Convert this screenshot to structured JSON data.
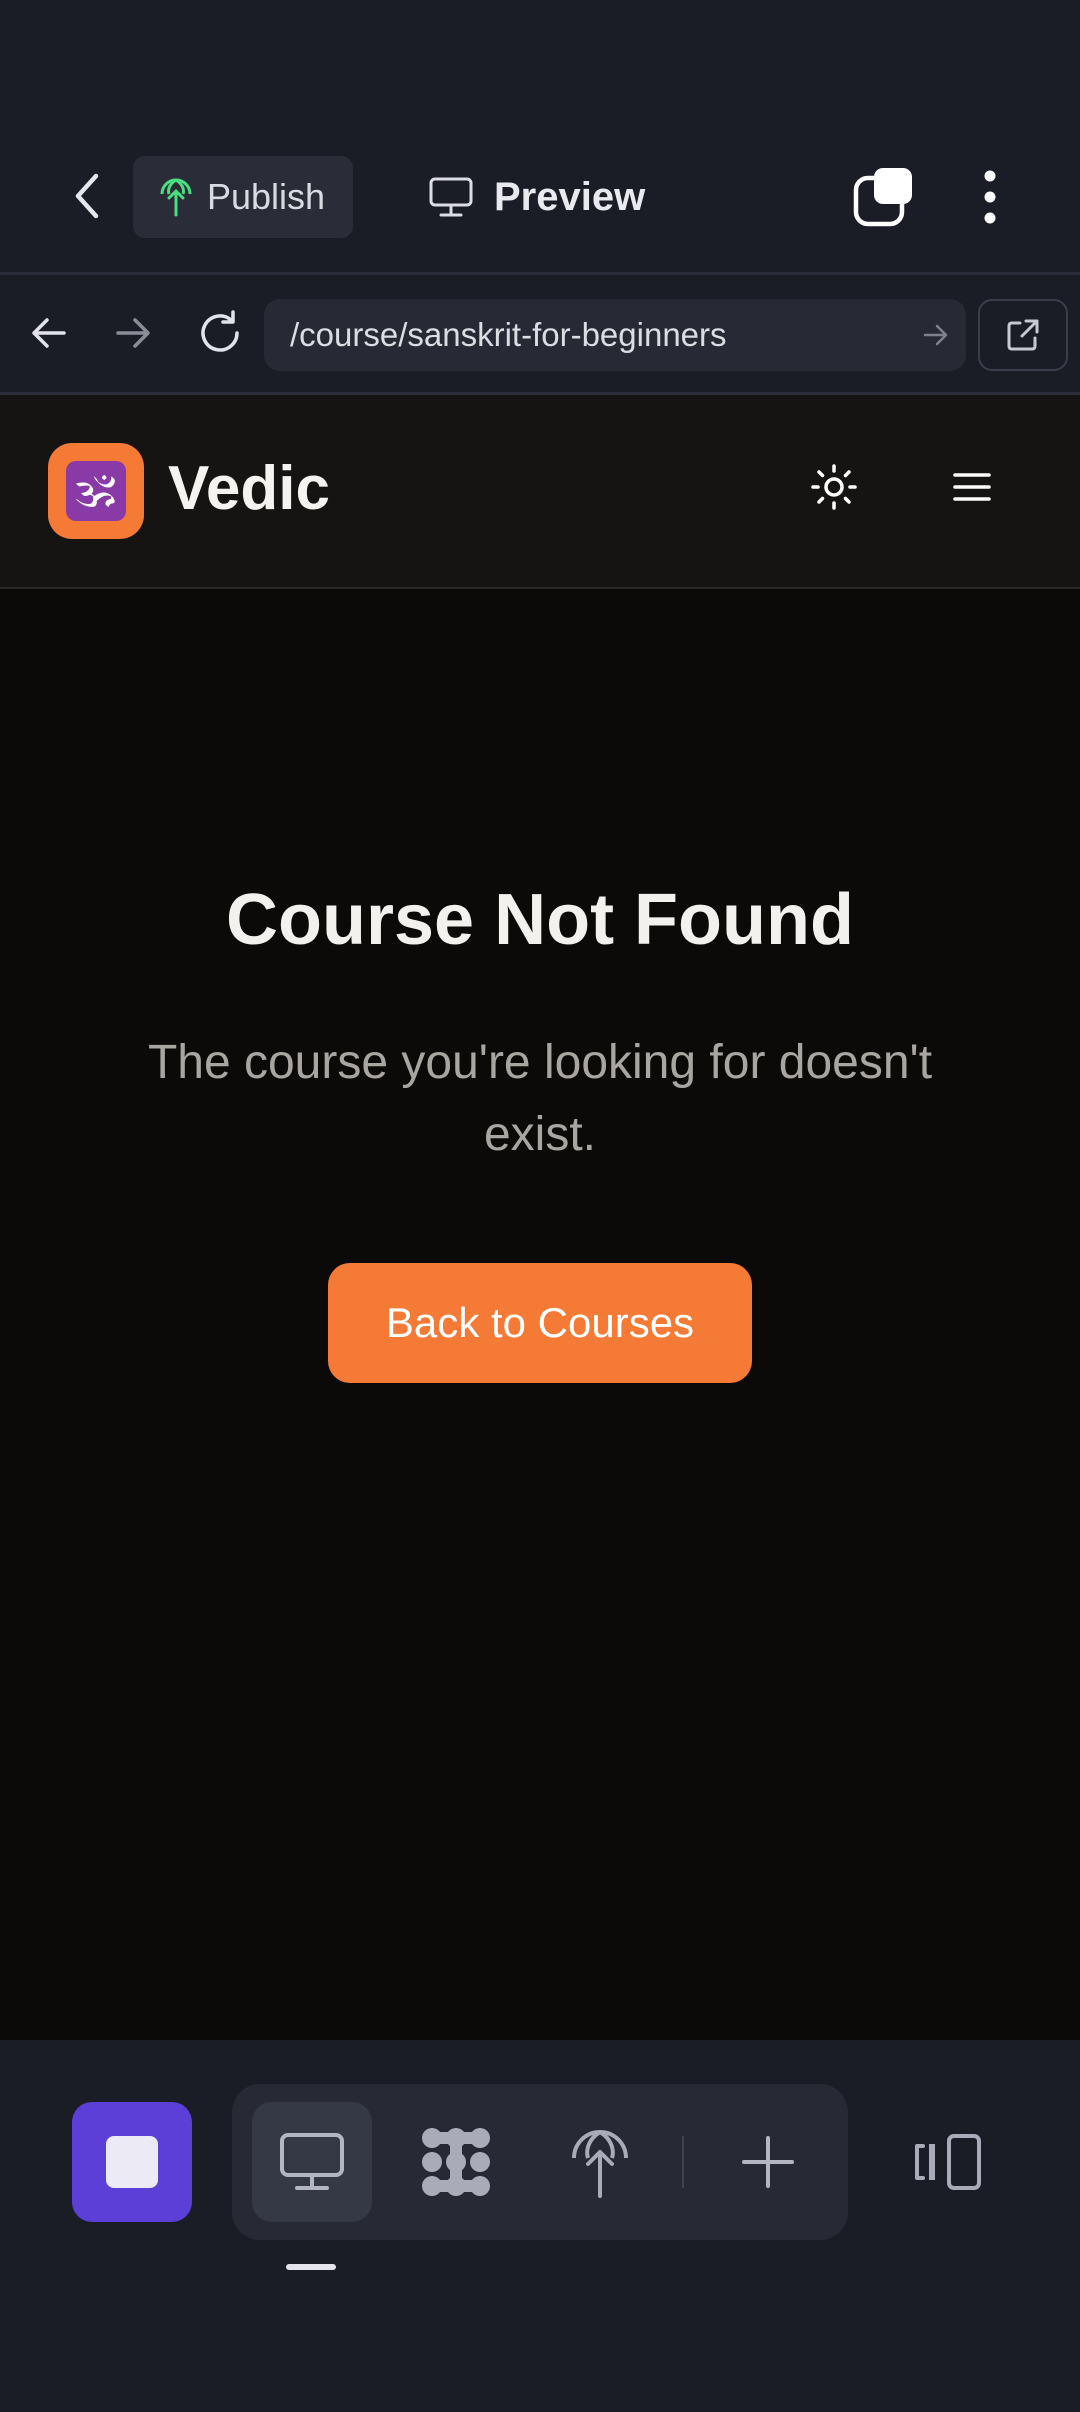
{
  "toolbar": {
    "publish_label": "Publish",
    "preview_label": "Preview",
    "icons": [
      "chevron-left-icon",
      "globe-upload-icon",
      "monitor-icon",
      "copy-icon",
      "more-vertical-icon"
    ]
  },
  "address_bar": {
    "url": "/course/sanskrit-for-beginners",
    "icons": [
      "arrow-left-icon",
      "arrow-right-icon",
      "reload-icon",
      "go-arrow-icon",
      "external-link-icon"
    ]
  },
  "site_header": {
    "logo_glyph": "🕉",
    "brand_name": "Vedic",
    "icons": [
      "sun-icon",
      "hamburger-menu-icon"
    ]
  },
  "main": {
    "title": "Course Not Found",
    "message": "The course you're looking for doesn't exist.",
    "back_button_label": "Back to Courses"
  },
  "bottom_bar": {
    "icons": [
      "stop-icon",
      "desktop-icon",
      "cluster-icon",
      "globe-icon",
      "plus-icon",
      "layout-panels-icon"
    ]
  },
  "colors": {
    "accent_orange": "#f47a35",
    "stop_purple": "#5b3fd6",
    "app_chrome_bg": "#1a1c26",
    "page_bg": "#0b0a09",
    "publish_icon_green": "#4ade80"
  }
}
